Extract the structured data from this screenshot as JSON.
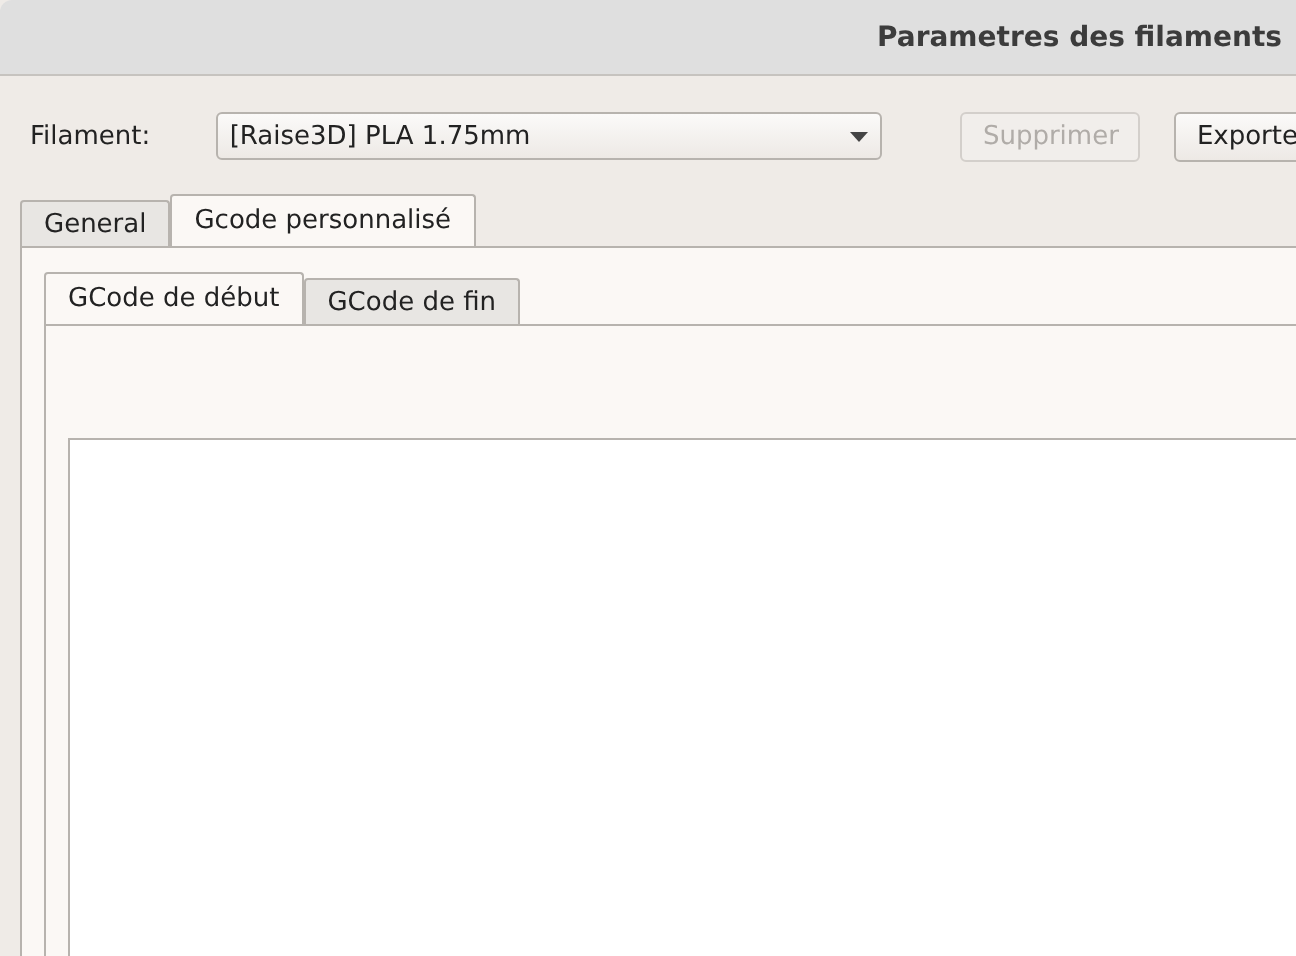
{
  "window": {
    "title": "Parametres des filaments"
  },
  "filament": {
    "label": "Filament:",
    "value": "[Raise3D] PLA 1.75mm"
  },
  "buttons": [
    {
      "label": "Supprimer",
      "disabled": true
    },
    {
      "label": "Exporte",
      "disabled": false
    }
  ],
  "tabs": [
    {
      "label": "General",
      "selected": false
    },
    {
      "label": "Gcode personnalisé",
      "selected": true
    }
  ],
  "subtabs": [
    {
      "label": "GCode de début",
      "selected": true
    },
    {
      "label": "GCode de fin",
      "selected": false
    }
  ]
}
